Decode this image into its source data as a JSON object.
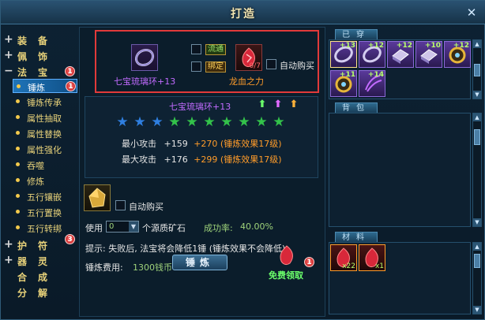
{
  "window": {
    "title": "打造"
  },
  "sidebar": {
    "top_items": [
      {
        "label": "装备"
      },
      {
        "label": "佩饰"
      },
      {
        "label": "法宝",
        "badge": "1"
      }
    ],
    "sub_items": [
      {
        "label": "锤炼",
        "active": true,
        "badge": "1"
      },
      {
        "label": "锤炼传承"
      },
      {
        "label": "属性抽取"
      },
      {
        "label": "属性替换"
      },
      {
        "label": "属性强化"
      },
      {
        "label": "吞噬"
      },
      {
        "label": "修炼"
      },
      {
        "label": "五行镶嵌"
      },
      {
        "label": "五行置换"
      },
      {
        "label": "五行转绑"
      }
    ],
    "bottom_items": [
      {
        "label": "护符",
        "badge": "3"
      },
      {
        "label": "器灵"
      },
      {
        "label": "合成"
      },
      {
        "label": "分解"
      }
    ]
  },
  "forge": {
    "item_name": "七宝琉璃环+13",
    "tag_circulate": "流通",
    "tag_bind": "绑定",
    "material_name": "龙血之力",
    "material_count": "0/7",
    "auto_buy_label": "自动购买",
    "info_item_name": "七宝琉璃环+13",
    "stars_total": 10,
    "stars_blue": 3,
    "stat_min_label": "最小攻击",
    "stat_min_base": "+159",
    "stat_min_bonus": "+270 (锤炼效果17级)",
    "stat_max_label": "最大攻击",
    "stat_max_base": "+176",
    "stat_max_bonus": "+299 (锤炼效果17级)",
    "use_label": "使用",
    "use_value": "0",
    "use_suffix": "个源质矿石",
    "success_label": "成功率:",
    "success_value": "40.00%",
    "auto_buy_label2": "自动购买",
    "hint": "提示: 失败后, 法宝将会降低1锤 (锤炼效果不会降低)",
    "cost_label": "锤炼费用:",
    "cost_value": "1300钱币",
    "forge_button": "锤炼",
    "free_claim": "免费领取",
    "free_badge": "1"
  },
  "inventory": {
    "equipped_tab": "已穿",
    "bag_tab": "背包",
    "materials_tab": "材料",
    "equipped": [
      {
        "level": "+13",
        "type": "ring"
      },
      {
        "level": "+12",
        "type": "ring"
      },
      {
        "level": "+12",
        "type": "book"
      },
      {
        "level": "+10",
        "type": "book"
      },
      {
        "level": "+12",
        "type": "amulet"
      },
      {
        "level": "+11",
        "type": "amulet"
      },
      {
        "level": "+14",
        "type": "claw"
      }
    ],
    "materials": [
      {
        "count": "x22"
      },
      {
        "count": "x1"
      }
    ]
  },
  "colors": {
    "gold": "#e8d27a",
    "purple": "#c26bff",
    "green": "#66d93a",
    "orange": "#ff9c2a",
    "highlight": "#e13a3a"
  }
}
